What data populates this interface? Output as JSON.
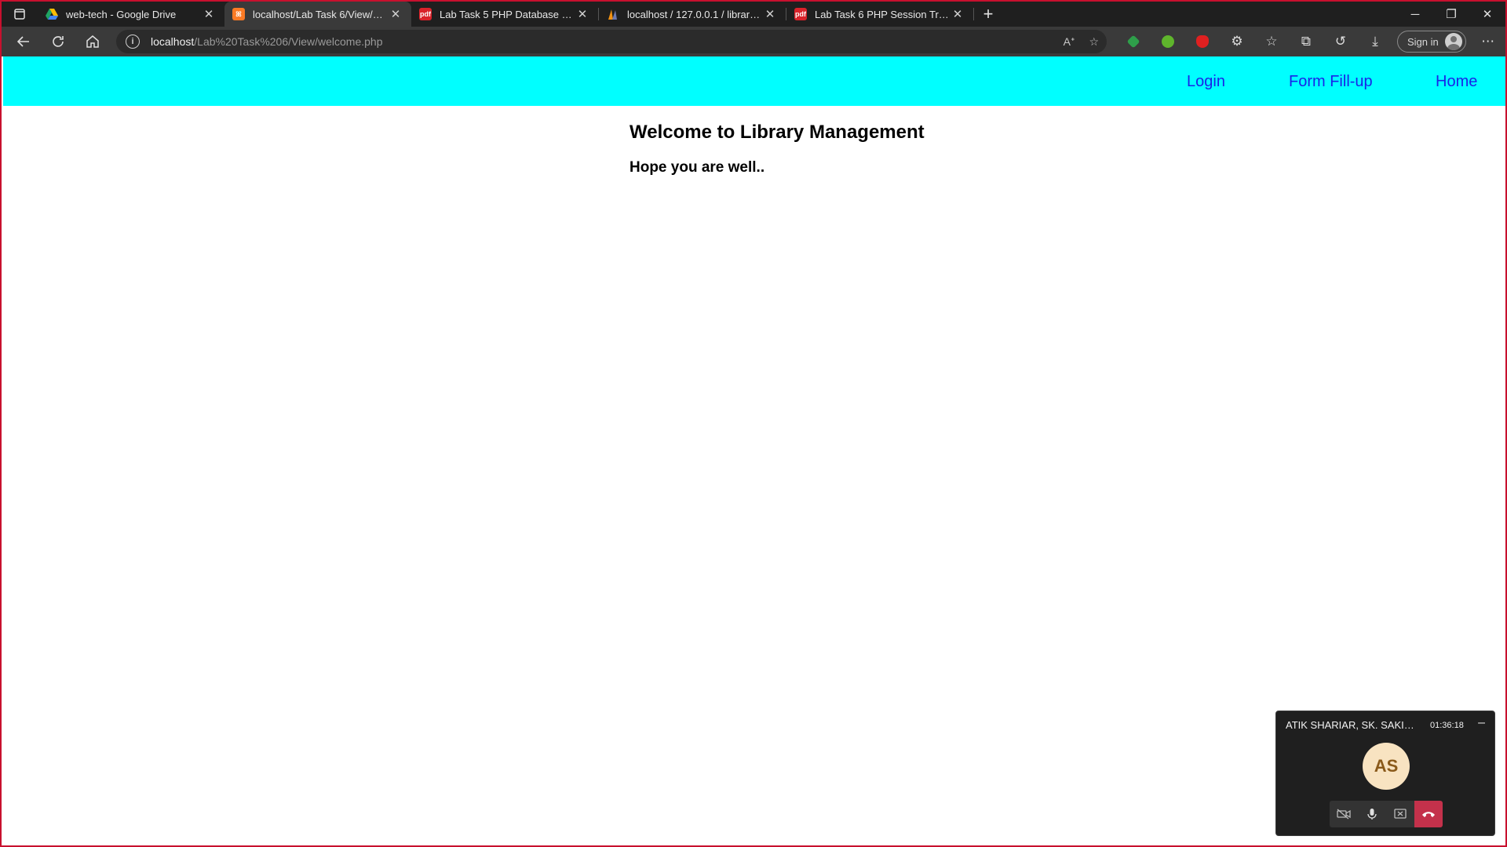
{
  "browser": {
    "tabs": [
      {
        "title": "web-tech - Google Drive",
        "favicon": "google-drive-icon",
        "color": "#1fa463"
      },
      {
        "title": "localhost/Lab Task 6/View/welco",
        "favicon": "xampp-icon",
        "color": "#fb7a24"
      },
      {
        "title": "Lab Task 5 PHP Database Conne",
        "favicon": "pdf-icon",
        "color": "#d9222a"
      },
      {
        "title": "localhost / 127.0.0.1 / library / lib",
        "favicon": "phpmyadmin-icon",
        "color": "#f29111"
      },
      {
        "title": "Lab Task 6 PHP Session Tracking",
        "favicon": "pdf-icon",
        "color": "#d9222a"
      }
    ],
    "address": {
      "host": "localhost",
      "path": "/Lab%20Task%206/View/welcome.php"
    },
    "signin_label": "Sign in"
  },
  "navbar": {
    "bg_color": "#00ffff",
    "links": [
      "Login",
      "Form Fill-up",
      "Home"
    ]
  },
  "page": {
    "heading": "Welcome to Library Management",
    "subheading": "Hope you are well.."
  },
  "call": {
    "participants": "ATIK SHARIAR, SK. SAKIB ...",
    "duration": "01:36:18",
    "initials": "AS",
    "hangup_color": "#c4314b"
  }
}
